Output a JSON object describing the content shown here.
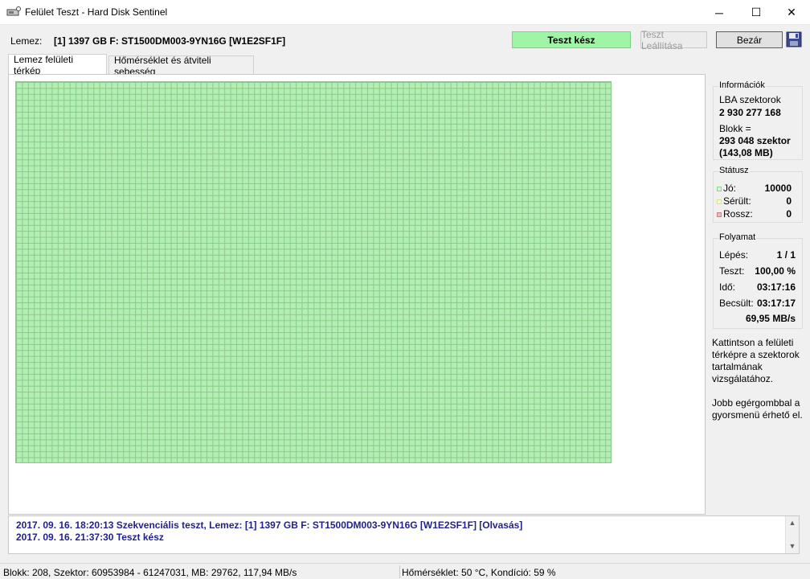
{
  "window": {
    "title": "Felület Teszt - Hard Disk Sentinel",
    "minimize": "─",
    "maximize": "☐",
    "close": "✕"
  },
  "toolbar": {
    "disk_label": "Lemez:",
    "disk_value": "[1] 1397 GB F: ST1500DM003-9YN16G [W1E2SF1F]",
    "status": "Teszt kész",
    "stop_label": "Teszt Leállítása",
    "exit_label": "Bezár"
  },
  "tabs": [
    {
      "label": "Lemez felületi térkép",
      "active": true
    },
    {
      "label": "Hőmérséklet és átviteli sebesség",
      "active": false
    }
  ],
  "info": {
    "title": "Információk",
    "lba_label": "LBA szektorok",
    "lba_value": "2 930 277 168",
    "block_label": "Blokk =",
    "block_value": "293 048 szektor",
    "block_size": "(143,08 MB)"
  },
  "status": {
    "title": "Státusz",
    "good_label": "Jó:",
    "good_value": "10000",
    "damaged_label": "Sérült:",
    "damaged_value": "0",
    "bad_label": "Rossz:",
    "bad_value": "0",
    "good_color": "#8ed68e",
    "damaged_color": "#e8e89a",
    "bad_color": "#d87e7e"
  },
  "progress": {
    "title": "Folyamat",
    "step_label": "Lépés:",
    "step_value": "1 / 1",
    "test_label": "Teszt:",
    "test_value": "100,00 %",
    "time_label": "Idő:",
    "time_value": "03:17:16",
    "est_label": "Becsült:",
    "est_value": "03:17:17",
    "speed": "69,95 MB/s"
  },
  "hints": {
    "click": "Kattintson a felületi térképre a szektorok tartalmának vizsgálatához.",
    "right": "Jobb egérgombbal a gyorsmenü érhető el."
  },
  "log": [
    "2017. 09. 16.  18:20:13   Szekvenciális teszt, Lemez: [1] 1397 GB F: ST1500DM003-9YN16G [W1E2SF1F] [Olvasás]",
    "2017. 09. 16.  21:37:30   Teszt kész"
  ],
  "statusbar": {
    "left": "Blokk: 208, Szektor: 60953984 - 61247031, MB: 29762, 117,94 MB/s",
    "right": "Hőmérséklet: 50  °C,  Kondíció: 59 %"
  },
  "colors": {
    "map_green": "#b5eeb5",
    "status_ok": "#9ff5a5",
    "log_text": "#1f1f8f"
  }
}
